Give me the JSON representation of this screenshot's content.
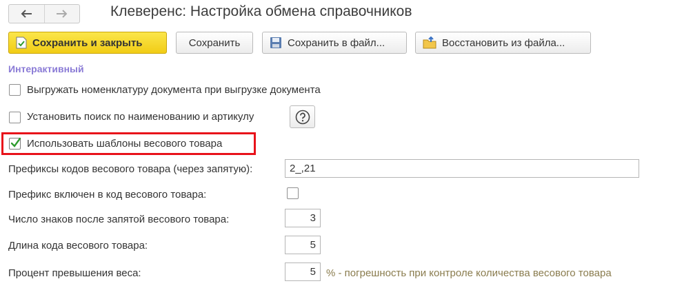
{
  "window": {
    "title": "Клеверенс: Настройка обмена справочников"
  },
  "nav": {
    "back_icon": "arrow-left-icon",
    "forward_icon": "arrow-right-icon"
  },
  "toolbar": {
    "save_close_label": "Сохранить и закрыть",
    "save_label": "Сохранить",
    "save_to_file_label": "Сохранить в файл...",
    "restore_from_file_label": "Восстановить из файла..."
  },
  "section": {
    "title": "Интерактивный"
  },
  "options": {
    "export_nomenclature": {
      "label": "Выгружать номенклатуру документа при выгрузке документа",
      "checked": false
    },
    "search_by_name": {
      "label": "Установить поиск по наименованию и артикулу",
      "checked": false
    },
    "use_weight_templates": {
      "label": "Использовать шаблоны весового товара",
      "checked": true
    }
  },
  "form": {
    "prefixes": {
      "label": "Префиксы кодов весового товара (через запятую):",
      "value": "2_,21"
    },
    "prefix_included": {
      "label": "Префикс включен в код весового товара:",
      "checked": false
    },
    "decimals": {
      "label": "Число знаков после запятой весового товара:",
      "value": "3"
    },
    "code_length": {
      "label": "Длина кода весового товара:",
      "value": "5"
    },
    "weight_excess": {
      "label": "Процент превышения веса:",
      "value": "5",
      "hint": "% -  погрешность при контроле количества весового товара"
    }
  },
  "colors": {
    "primary_button": "#f5d21f",
    "section_title": "#8a7bd6",
    "highlight_border": "#e8121a",
    "checkmark": "#2e9b2e",
    "hint_text": "#8a7c4e"
  }
}
